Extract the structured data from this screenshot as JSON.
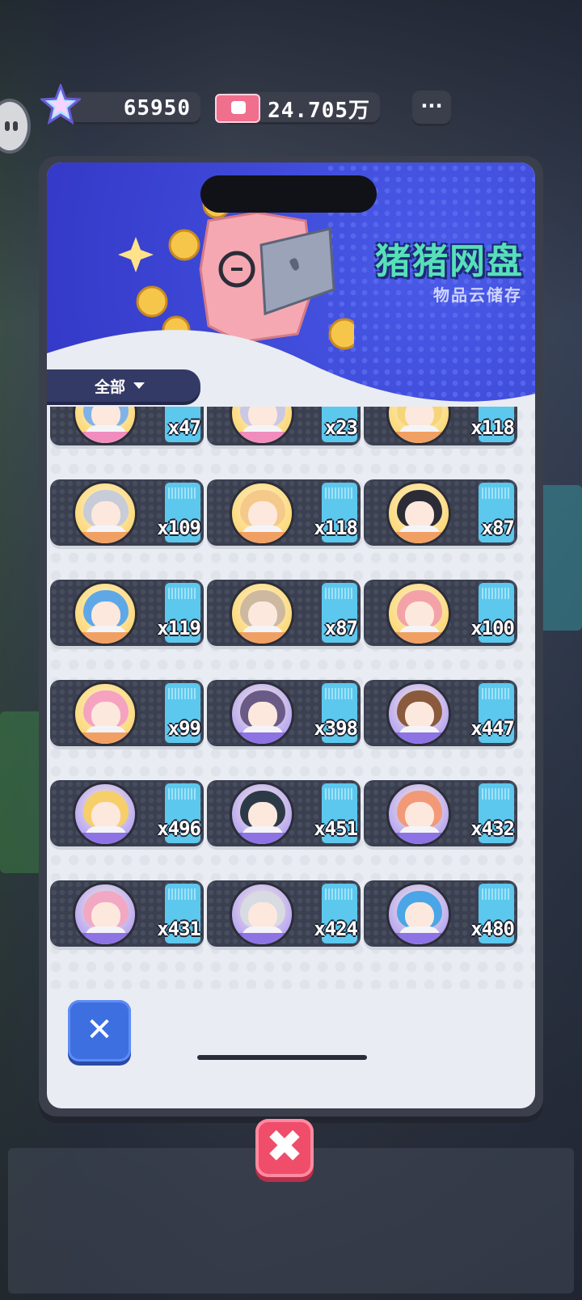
{
  "currency": {
    "gems": "65950",
    "tickets": "24.705万",
    "more": "···"
  },
  "panel": {
    "title": "猪猪网盘",
    "subtitle": "物品云储存",
    "filter": "全部"
  },
  "close_small": "✕",
  "close_big": "✖",
  "items": [
    {
      "count": "x47",
      "hair": "#7fb3e8",
      "band": "#f07ab4"
    },
    {
      "count": "x23",
      "hair": "#c9c8e6",
      "band": "#f07ab4"
    },
    {
      "count": "x118",
      "hair": "#f6d57a",
      "band": "#f0904a"
    },
    {
      "count": "x109",
      "hair": "#c7ccd8",
      "band": "#f0904a"
    },
    {
      "count": "x118",
      "hair": "#f5c98a",
      "band": "#f0904a"
    },
    {
      "count": "x87",
      "hair": "#2b2c36",
      "band": "#f0904a"
    },
    {
      "count": "x119",
      "hair": "#5fa8e8",
      "band": "#f0904a"
    },
    {
      "count": "x87",
      "hair": "#cdb9a0",
      "band": "#f0904a"
    },
    {
      "count": "x100",
      "hair": "#f3a3a8",
      "band": "#f0904a"
    },
    {
      "count": "x99",
      "hair": "#f5a3c0",
      "band": "#f0904a"
    },
    {
      "count": "x398",
      "hair": "#6a5a86",
      "band": "#7a5ce0"
    },
    {
      "count": "x447",
      "hair": "#8a5a3c",
      "band": "#7a5ce0"
    },
    {
      "count": "x496",
      "hair": "#f6cf6a",
      "band": "#7a5ce0"
    },
    {
      "count": "x451",
      "hair": "#2c3a48",
      "band": "#7a5ce0"
    },
    {
      "count": "x432",
      "hair": "#f29a78",
      "band": "#7a5ce0"
    },
    {
      "count": "x431",
      "hair": "#f2a8c2",
      "band": "#7a5ce0"
    },
    {
      "count": "x424",
      "hair": "#d9dbe2",
      "band": "#7a5ce0"
    },
    {
      "count": "x480",
      "hair": "#4aa6e6",
      "band": "#7a5ce0"
    }
  ]
}
